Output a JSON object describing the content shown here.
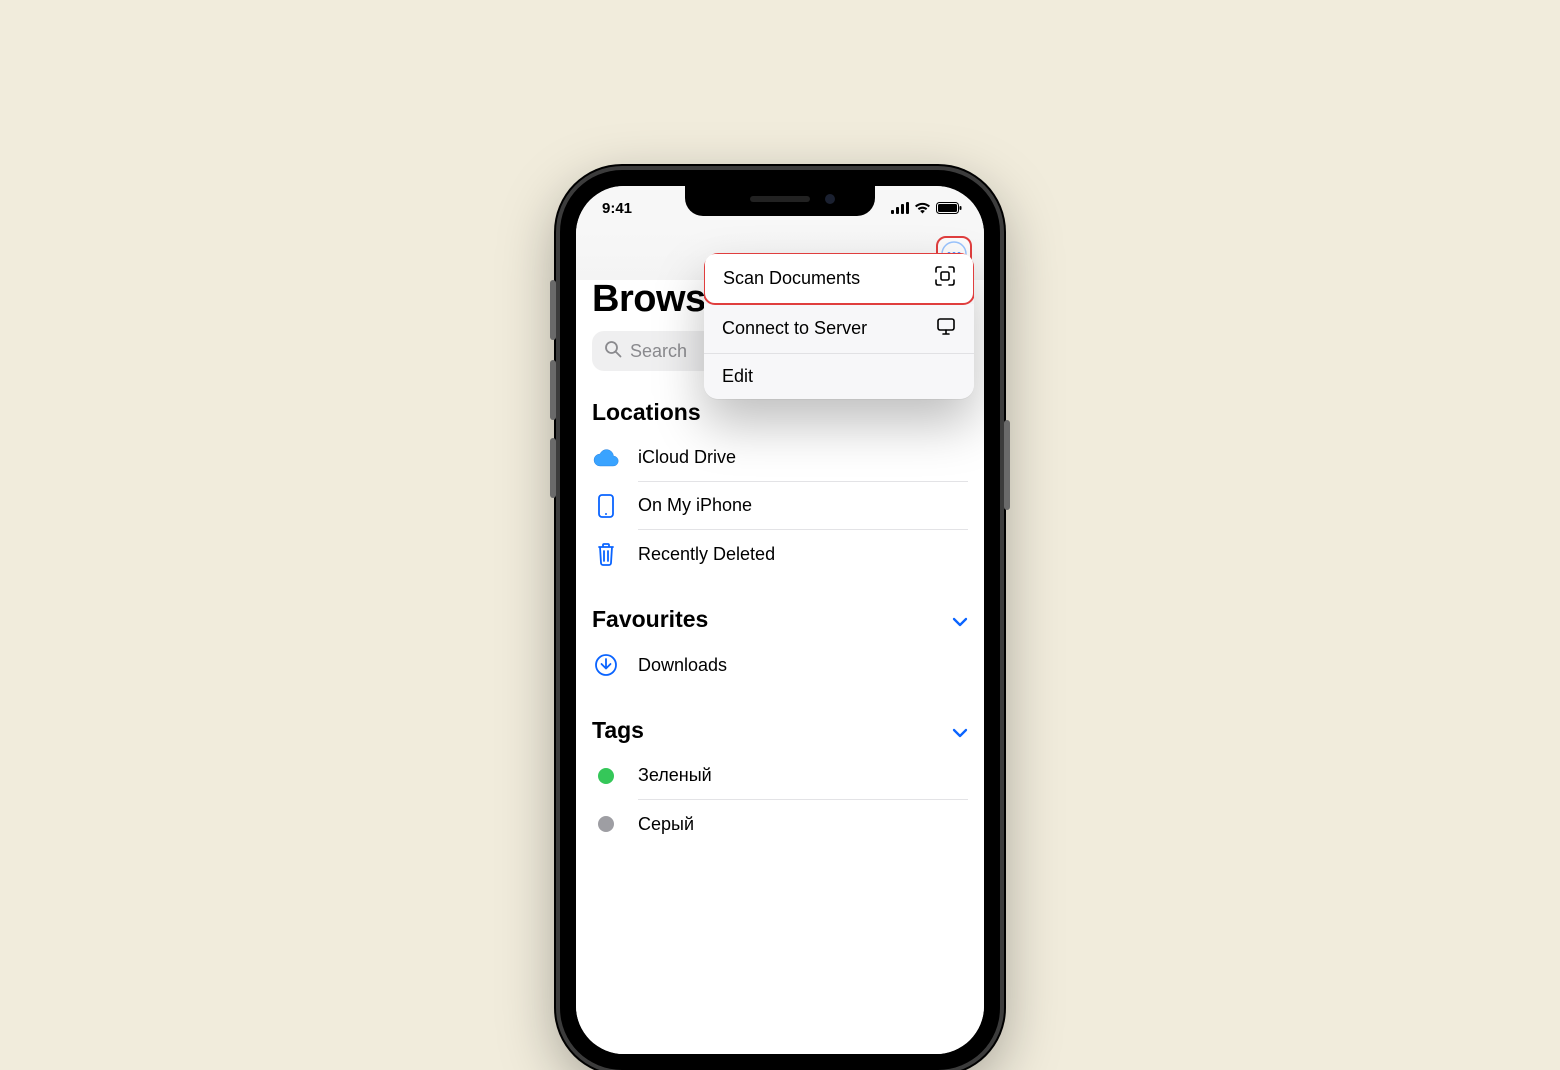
{
  "status": {
    "time": "9:41"
  },
  "page_title": "Browse",
  "search": {
    "placeholder": "Search"
  },
  "menu": {
    "items": [
      {
        "label": "Scan Documents",
        "icon": "scan-icon",
        "highlight": true
      },
      {
        "label": "Connect to Server",
        "icon": "monitor-icon",
        "highlight": false
      },
      {
        "label": "Edit",
        "icon": "",
        "highlight": false
      }
    ]
  },
  "sections": {
    "locations": {
      "title": "Locations",
      "items": [
        {
          "label": "iCloud Drive",
          "icon": "cloud-icon"
        },
        {
          "label": "On My iPhone",
          "icon": "iphone-icon"
        },
        {
          "label": "Recently Deleted",
          "icon": "trash-icon"
        }
      ]
    },
    "favourites": {
      "title": "Favourites",
      "items": [
        {
          "label": "Downloads",
          "icon": "download-circle-icon"
        }
      ]
    },
    "tags": {
      "title": "Tags",
      "items": [
        {
          "label": "Зеленый",
          "color": "#35c759"
        },
        {
          "label": "Серый",
          "color": "#9e9ea3"
        }
      ]
    }
  }
}
